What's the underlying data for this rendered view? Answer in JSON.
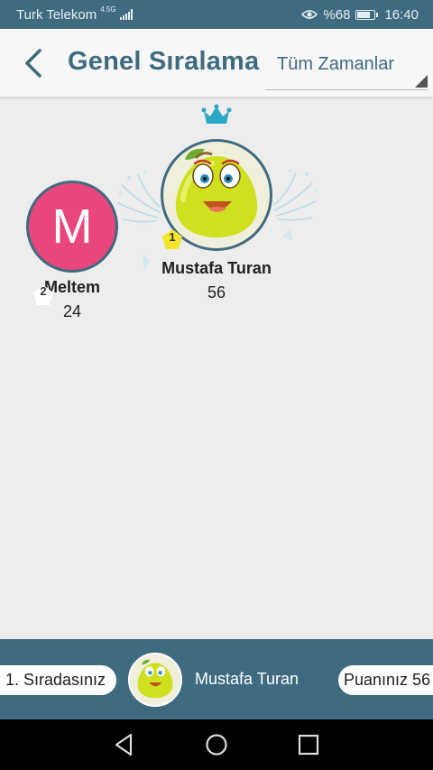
{
  "status_bar": {
    "carrier": "Turk Telekom",
    "network": "4.5G",
    "battery_text": "%68",
    "battery_level": 0.68,
    "time": "16:40",
    "icons": [
      "signal-icon",
      "eye-icon",
      "battery-icon"
    ]
  },
  "header": {
    "title": "Genel Sıralama",
    "period_selected": "Tüm Zamanlar",
    "back_icon": "chevron-left-icon"
  },
  "podium": [
    {
      "rank": "1",
      "name": "Mustafa Turan",
      "score": "56",
      "avatar": "pear-character-icon",
      "badge_color": "#f4e52a"
    },
    {
      "rank": "2",
      "name": "Meltem",
      "score": "24",
      "avatar_letter": "M",
      "avatar_color": "#e8467c",
      "badge_color": "#ffffff"
    }
  ],
  "decorations": {
    "crown_icon": "crown-icon",
    "confetti_icon": "confetti-icon"
  },
  "footer": {
    "rank_text": "1. Sıradasınız",
    "name": "Mustafa Turan",
    "score_text": "Puanınız 56"
  },
  "colors": {
    "primary": "#3f6b80",
    "accent_pink": "#e8467c",
    "gold": "#f4e52a",
    "crown": "#2aa8c4"
  },
  "nav_bar": {
    "buttons": [
      "back-triangle-icon",
      "home-circle-icon",
      "recents-square-icon"
    ]
  }
}
